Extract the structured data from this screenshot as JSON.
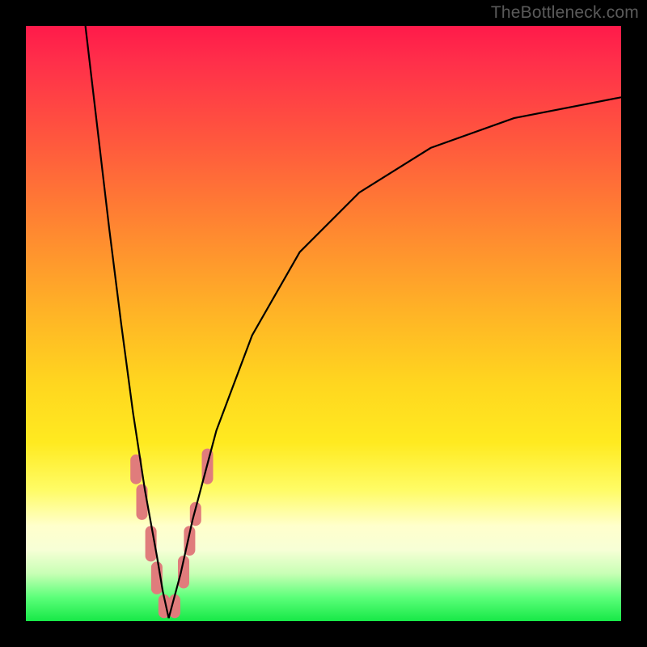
{
  "watermark": "TheBottleneck.com",
  "colors": {
    "frame": "#000000",
    "curve": "#000000",
    "marker": "#e07c7c",
    "gradient_top": "#ff1a4a",
    "gradient_bottom": "#17e847"
  },
  "chart_data": {
    "type": "line",
    "title": "",
    "xlabel": "",
    "ylabel": "",
    "xlim": [
      0,
      100
    ],
    "ylim": [
      0,
      100
    ],
    "notes": "V-shaped bottleneck curve on color gradient. No axis ticks or labels rendered. Minimum of curve at roughly x≈24, y≈0. Markers are short vertical pill highlights along both arms of the V in the lower yellow/green region.",
    "series": [
      {
        "name": "left-arm",
        "x": [
          10.0,
          12.0,
          14.0,
          16.0,
          18.0,
          20.0,
          22.0,
          23.0,
          24.0
        ],
        "y": [
          100.0,
          83.0,
          66.0,
          50.0,
          35.0,
          22.0,
          11.0,
          5.0,
          0.5
        ]
      },
      {
        "name": "right-arm",
        "x": [
          24.0,
          26.0,
          28.0,
          32.0,
          38.0,
          46.0,
          56.0,
          68.0,
          82.0,
          100.0
        ],
        "y": [
          0.5,
          8.0,
          17.0,
          32.0,
          48.0,
          62.0,
          72.0,
          79.5,
          84.5,
          88.0
        ]
      }
    ],
    "markers": [
      {
        "x": 18.5,
        "y0": 23,
        "y1": 28
      },
      {
        "x": 19.5,
        "y0": 17,
        "y1": 23
      },
      {
        "x": 21.0,
        "y0": 10,
        "y1": 16
      },
      {
        "x": 22.0,
        "y0": 4.5,
        "y1": 10
      },
      {
        "x": 23.2,
        "y0": 0.5,
        "y1": 4.5
      },
      {
        "x": 25.0,
        "y0": 0.5,
        "y1": 4.5
      },
      {
        "x": 26.5,
        "y0": 5.5,
        "y1": 11
      },
      {
        "x": 27.5,
        "y0": 11,
        "y1": 16
      },
      {
        "x": 28.5,
        "y0": 16,
        "y1": 20
      },
      {
        "x": 30.5,
        "y0": 23,
        "y1": 29
      }
    ]
  }
}
